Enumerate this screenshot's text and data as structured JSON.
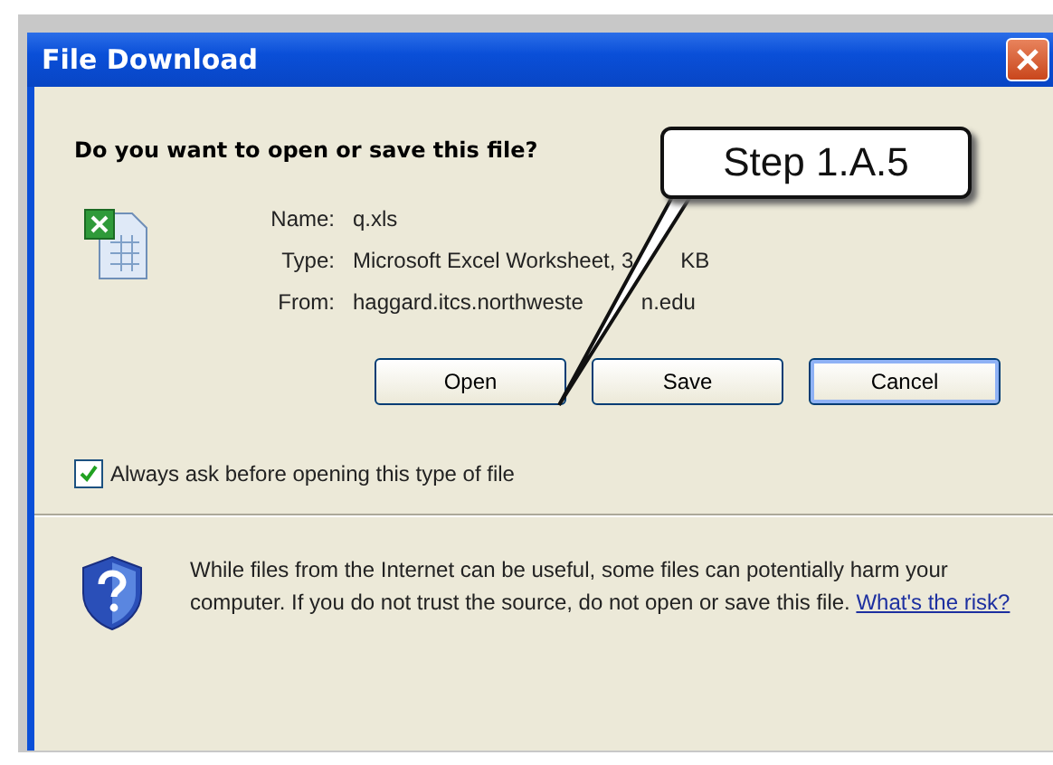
{
  "window": {
    "title": "File Download"
  },
  "question": "Do you want to open or save this file?",
  "file_info": [
    {
      "label": "Name:",
      "value": "q.xls"
    },
    {
      "label": "Type:",
      "value": "Microsoft Excel Worksheet, 3",
      "value_rest": "KB"
    },
    {
      "label": "From:",
      "value": "haggard.itcs.northweste",
      "value_rest": "n.edu"
    }
  ],
  "buttons": [
    {
      "label": "Open",
      "selected": false
    },
    {
      "label": "Save",
      "selected": false
    },
    {
      "label": "Cancel",
      "selected": true
    }
  ],
  "always_ask": {
    "label": "Always ask before opening this type of file",
    "checked": true
  },
  "warning": {
    "text": "While files from the Internet can be useful, some files can potentially harm your computer. If you do not trust the source, do not open or save this file.",
    "link": "What's the risk?"
  },
  "callout": {
    "text": "Step 1.A.5"
  }
}
